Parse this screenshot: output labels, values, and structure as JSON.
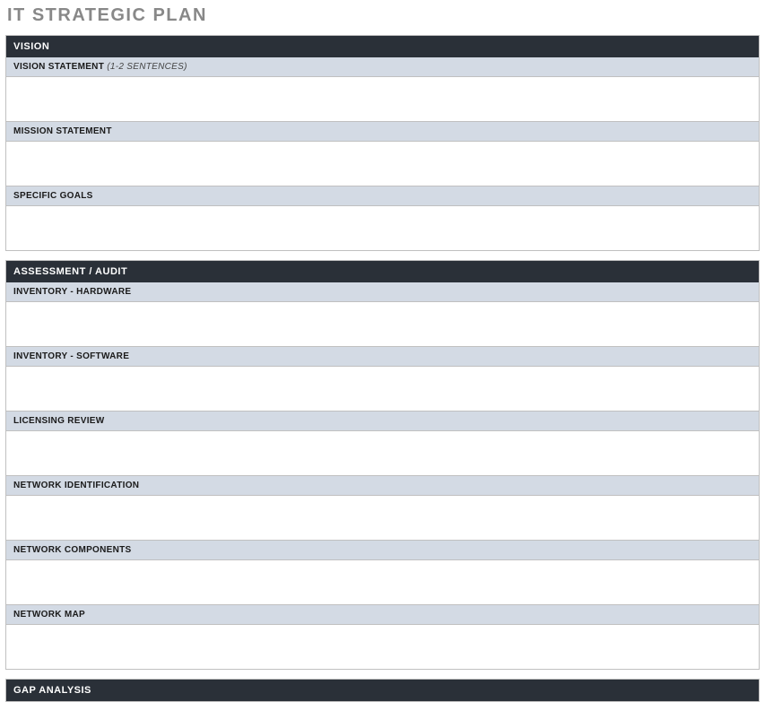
{
  "title": "IT STRATEGIC PLAN",
  "vision": {
    "header": "VISION",
    "vision_statement": {
      "label": "VISION STATEMENT",
      "hint": "(1-2 SENTENCES)",
      "value": ""
    },
    "mission_statement": {
      "label": "MISSION STATEMENT",
      "value": ""
    },
    "specific_goals": {
      "label": "SPECIFIC GOALS",
      "value": ""
    }
  },
  "assessment": {
    "header": "ASSESSMENT / AUDIT",
    "inventory_hardware": {
      "label": "INVENTORY - HARDWARE",
      "value": ""
    },
    "inventory_software": {
      "label": "INVENTORY - SOFTWARE",
      "value": ""
    },
    "licensing_review": {
      "label": "LICENSING REVIEW",
      "value": ""
    },
    "network_identification": {
      "label": "NETWORK IDENTIFICATION",
      "value": ""
    },
    "network_components": {
      "label": "NETWORK COMPONENTS",
      "value": ""
    },
    "network_map": {
      "label": "NETWORK MAP",
      "value": ""
    }
  },
  "gap_analysis": {
    "header": "GAP ANALYSIS"
  }
}
